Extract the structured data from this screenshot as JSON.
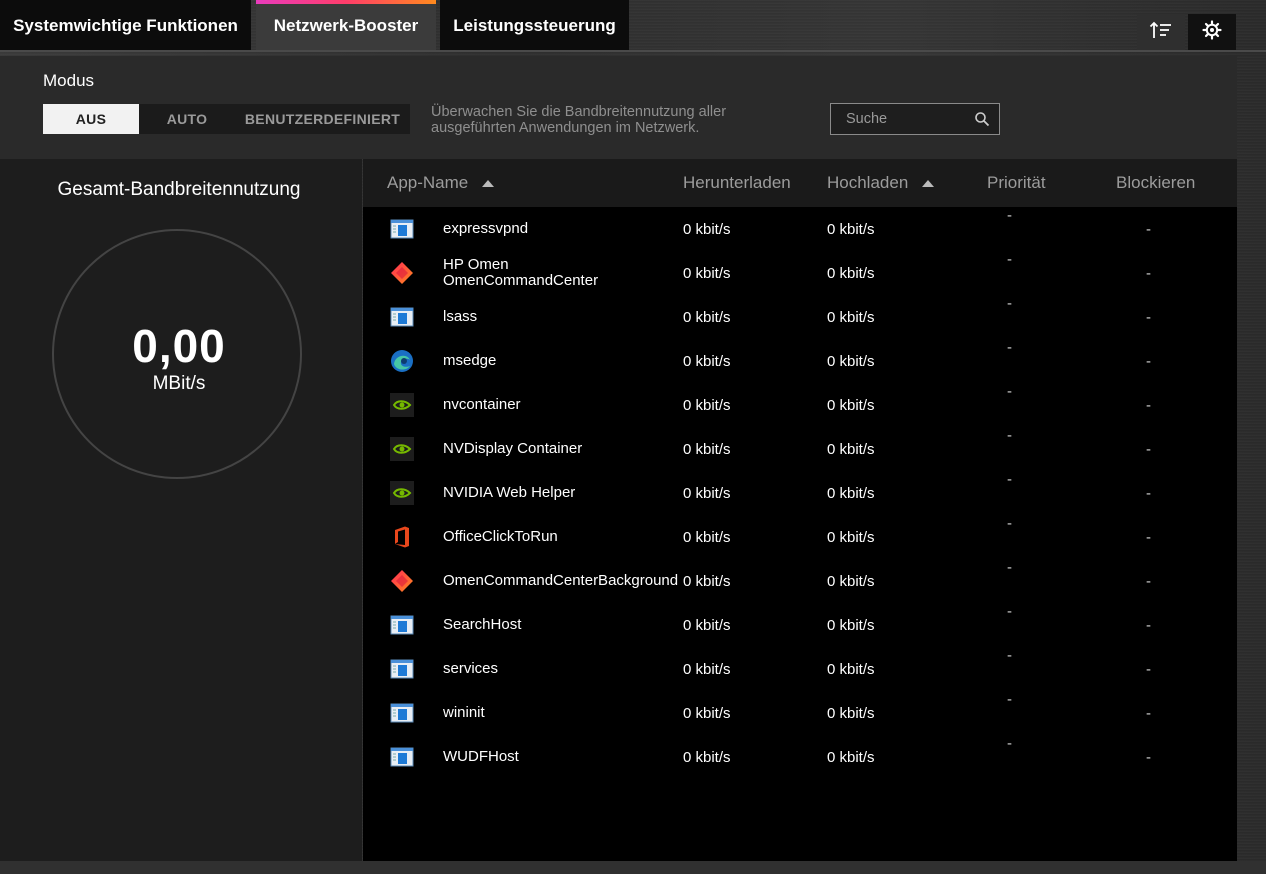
{
  "tabs": [
    {
      "label": "Systemwichtige Funktionen"
    },
    {
      "label": "Netzwerk-Booster"
    },
    {
      "label": "Leistungssteuerung"
    }
  ],
  "mode": {
    "label": "Modus",
    "options": [
      "AUS",
      "AUTO",
      "BENUTZERDEFINIERT"
    ],
    "selected": "AUS",
    "description": "Überwachen Sie die Bandbreitennutzung aller ausgeführten Anwendungen im Netzwerk."
  },
  "search": {
    "placeholder": "Suche",
    "value": ""
  },
  "bandwidth": {
    "title": "Gesamt-Bandbreitennutzung",
    "value": "0,00",
    "unit": "MBit/s"
  },
  "table": {
    "headers": {
      "name": "App-Name",
      "download": "Herunterladen",
      "upload": "Hochladen",
      "priority": "Priorität",
      "block": "Blockieren"
    },
    "rows": [
      {
        "icon": "generic-app-icon",
        "name": "expressvpnd",
        "download": "0 kbit/s",
        "upload": "0 kbit/s",
        "priority": "-",
        "block": "-"
      },
      {
        "icon": "omen-icon",
        "name": "HP Omen OmenCommandCenter",
        "download": "0 kbit/s",
        "upload": "0 kbit/s",
        "priority": "-",
        "block": "-"
      },
      {
        "icon": "generic-app-icon",
        "name": "lsass",
        "download": "0 kbit/s",
        "upload": "0 kbit/s",
        "priority": "-",
        "block": "-"
      },
      {
        "icon": "edge-icon",
        "name": "msedge",
        "download": "0 kbit/s",
        "upload": "0 kbit/s",
        "priority": "-",
        "block": "-"
      },
      {
        "icon": "nvidia-icon",
        "name": "nvcontainer",
        "download": "0 kbit/s",
        "upload": "0 kbit/s",
        "priority": "-",
        "block": "-"
      },
      {
        "icon": "nvidia-icon",
        "name": "NVDisplay Container",
        "download": "0 kbit/s",
        "upload": "0 kbit/s",
        "priority": "-",
        "block": "-"
      },
      {
        "icon": "nvidia-icon",
        "name": "NVIDIA Web Helper",
        "download": "0 kbit/s",
        "upload": "0 kbit/s",
        "priority": "-",
        "block": "-"
      },
      {
        "icon": "office-icon",
        "name": "OfficeClickToRun",
        "download": "0 kbit/s",
        "upload": "0 kbit/s",
        "priority": "-",
        "block": "-"
      },
      {
        "icon": "omen-icon",
        "name": "OmenCommandCenterBackground",
        "download": "0 kbit/s",
        "upload": "0 kbit/s",
        "priority": "-",
        "block": "-"
      },
      {
        "icon": "generic-app-icon",
        "name": "SearchHost",
        "download": "0 kbit/s",
        "upload": "0 kbit/s",
        "priority": "-",
        "block": "-"
      },
      {
        "icon": "generic-app-icon",
        "name": "services",
        "download": "0 kbit/s",
        "upload": "0 kbit/s",
        "priority": "-",
        "block": "-"
      },
      {
        "icon": "generic-app-icon",
        "name": "wininit",
        "download": "0 kbit/s",
        "upload": "0 kbit/s",
        "priority": "-",
        "block": "-"
      },
      {
        "icon": "generic-app-icon",
        "name": "WUDFHost",
        "download": "0 kbit/s",
        "upload": "0 kbit/s",
        "priority": "-",
        "block": "-"
      }
    ]
  },
  "colors": {
    "accent_gradient_start": "#e93cbd",
    "accent_gradient_end": "#ff8a1e",
    "selected_mode_bg": "#f2f2f2"
  }
}
